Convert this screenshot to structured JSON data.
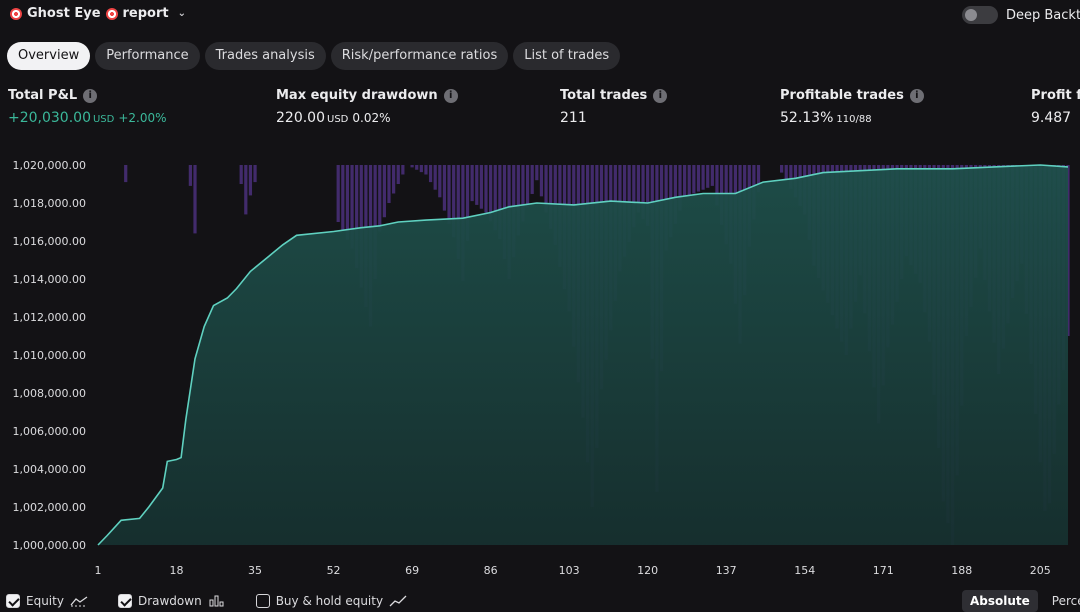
{
  "header": {
    "title_part1": "Ghost Eye",
    "title_part2": "report",
    "deep_backtest_label": "Deep Backte"
  },
  "tabs": [
    {
      "label": "Overview",
      "active": true
    },
    {
      "label": "Performance",
      "active": false
    },
    {
      "label": "Trades analysis",
      "active": false
    },
    {
      "label": "Risk/performance ratios",
      "active": false
    },
    {
      "label": "List of trades",
      "active": false
    }
  ],
  "metrics": {
    "total_pnl": {
      "label": "Total P&L",
      "value": "+20,030.00",
      "unit": "USD",
      "sub": "+2.00%"
    },
    "max_drawdown": {
      "label": "Max equity drawdown",
      "value": "220.00",
      "unit": "USD",
      "sub": "0.02%"
    },
    "total_trades": {
      "label": "Total trades",
      "value": "211"
    },
    "profitable_trades": {
      "label": "Profitable trades",
      "value": "52.13%",
      "sub": "110/88"
    },
    "profit_factor": {
      "label": "Profit fa",
      "value": "9.487"
    }
  },
  "chart_data": {
    "type": "line",
    "y_tick_labels": [
      "1,020,000.00",
      "1,018,000.00",
      "1,016,000.00",
      "1,014,000.00",
      "1,012,000.00",
      "1,010,000.00",
      "1,008,000.00",
      "1,006,000.00",
      "1,004,000.00",
      "1,002,000.00",
      "1,000,000.00"
    ],
    "x_tick_labels": [
      "1",
      "18",
      "35",
      "52",
      "69",
      "86",
      "103",
      "120",
      "137",
      "154",
      "171",
      "188",
      "205"
    ],
    "ylim": [
      1000000,
      1020000
    ],
    "xlim": [
      1,
      211
    ],
    "equity_points": [
      [
        1,
        1000000
      ],
      [
        3,
        1000500
      ],
      [
        6,
        1001300
      ],
      [
        10,
        1001400
      ],
      [
        12,
        1002000
      ],
      [
        15,
        1003000
      ],
      [
        16,
        1004400
      ],
      [
        18,
        1004500
      ],
      [
        19,
        1004600
      ],
      [
        20,
        1006600
      ],
      [
        22,
        1009800
      ],
      [
        24,
        1011500
      ],
      [
        26,
        1012600
      ],
      [
        29,
        1013000
      ],
      [
        31,
        1013500
      ],
      [
        34,
        1014400
      ],
      [
        38,
        1015200
      ],
      [
        41,
        1015800
      ],
      [
        44,
        1016300
      ],
      [
        52,
        1016500
      ],
      [
        58,
        1016700
      ],
      [
        62,
        1016800
      ],
      [
        66,
        1017000
      ],
      [
        72,
        1017100
      ],
      [
        80,
        1017200
      ],
      [
        86,
        1017500
      ],
      [
        90,
        1017800
      ],
      [
        96,
        1018000
      ],
      [
        104,
        1017900
      ],
      [
        112,
        1018100
      ],
      [
        120,
        1018000
      ],
      [
        126,
        1018300
      ],
      [
        132,
        1018500
      ],
      [
        139,
        1018500
      ],
      [
        145,
        1019100
      ],
      [
        152,
        1019300
      ],
      [
        158,
        1019600
      ],
      [
        166,
        1019700
      ],
      [
        174,
        1019800
      ],
      [
        186,
        1019800
      ],
      [
        195,
        1019900
      ],
      [
        205,
        1020000
      ],
      [
        211,
        1019900
      ]
    ],
    "drawdown_profile": [
      [
        1,
        0
      ],
      [
        6,
        0
      ],
      [
        7,
        900
      ],
      [
        8,
        0
      ],
      [
        20,
        0
      ],
      [
        21,
        1100
      ],
      [
        22,
        3600
      ],
      [
        23,
        0
      ],
      [
        31,
        0
      ],
      [
        32,
        1000
      ],
      [
        33,
        2600
      ],
      [
        34,
        1600
      ],
      [
        35,
        900
      ],
      [
        36,
        0
      ],
      [
        52,
        0
      ],
      [
        53,
        3000
      ],
      [
        56,
        4400
      ],
      [
        60,
        8500
      ],
      [
        62,
        3500
      ],
      [
        64,
        2000
      ],
      [
        68,
        0
      ],
      [
        72,
        500
      ],
      [
        75,
        1700
      ],
      [
        78,
        3800
      ],
      [
        80,
        6100
      ],
      [
        82,
        1900
      ],
      [
        85,
        2500
      ],
      [
        88,
        3900
      ],
      [
        90,
        6000
      ],
      [
        92,
        3700
      ],
      [
        96,
        800
      ],
      [
        100,
        4200
      ],
      [
        103,
        7700
      ],
      [
        106,
        13300
      ],
      [
        108,
        18000
      ],
      [
        110,
        11800
      ],
      [
        114,
        5600
      ],
      [
        118,
        2500
      ],
      [
        120,
        3200
      ],
      [
        122,
        17200
      ],
      [
        124,
        4500
      ],
      [
        128,
        1700
      ],
      [
        134,
        1100
      ],
      [
        138,
        5200
      ],
      [
        140,
        9400
      ],
      [
        142,
        4300
      ],
      [
        145,
        0
      ],
      [
        148,
        0
      ],
      [
        150,
        800
      ],
      [
        154,
        2600
      ],
      [
        156,
        5300
      ],
      [
        160,
        7900
      ],
      [
        163,
        10000
      ],
      [
        166,
        5800
      ],
      [
        168,
        9800
      ],
      [
        170,
        13600
      ],
      [
        172,
        9600
      ],
      [
        176,
        4800
      ],
      [
        179,
        6200
      ],
      [
        181,
        9300
      ],
      [
        184,
        17700
      ],
      [
        186,
        20000
      ],
      [
        189,
        9000
      ],
      [
        192,
        4400
      ],
      [
        196,
        11000
      ],
      [
        199,
        7000
      ],
      [
        201,
        5200
      ],
      [
        204,
        13100
      ],
      [
        206,
        18200
      ],
      [
        207,
        17800
      ],
      [
        209,
        12600
      ],
      [
        211,
        9000
      ]
    ]
  },
  "legend": {
    "equity": {
      "label": "Equity",
      "checked": true
    },
    "drawdown": {
      "label": "Drawdown",
      "checked": true
    },
    "buy_hold": {
      "label": "Buy & hold equity",
      "checked": false
    }
  },
  "view_toggle": {
    "absolute": "Absolute",
    "percent": "Perce"
  }
}
